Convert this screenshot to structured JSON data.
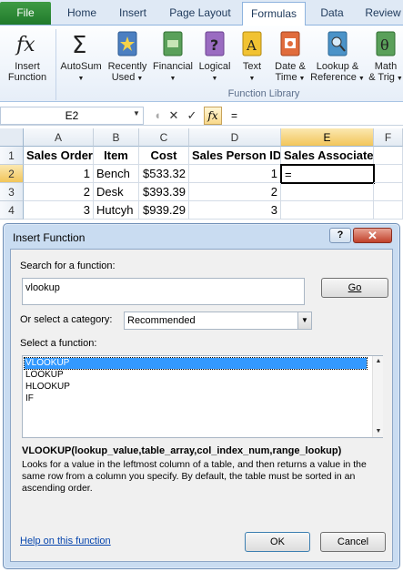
{
  "ribbon": {
    "tabs": [
      "File",
      "Home",
      "Insert",
      "Page Layout",
      "Formulas",
      "Data",
      "Review"
    ],
    "active_tab": "Formulas",
    "buttons": [
      {
        "label": "Insert\nFunction",
        "icon": "fx-icon"
      },
      {
        "label": "AutoSum",
        "icon": "sigma-icon"
      },
      {
        "label": "Recently\nUsed",
        "icon": "star-book-icon"
      },
      {
        "label": "Financial",
        "icon": "money-book-icon"
      },
      {
        "label": "Logical",
        "icon": "question-book-icon"
      },
      {
        "label": "Text",
        "icon": "text-book-icon"
      },
      {
        "label": "Date &\nTime",
        "icon": "calendar-book-icon"
      },
      {
        "label": "Lookup &\nReference",
        "icon": "magnifier-book-icon"
      },
      {
        "label": "Math\n& Trig",
        "icon": "theta-book-icon"
      }
    ],
    "group_label": "Function Library"
  },
  "formula_bar": {
    "name_box": "E2",
    "formula": "="
  },
  "grid": {
    "columns": [
      "A",
      "B",
      "C",
      "D",
      "E",
      "F"
    ],
    "rows": [
      "1",
      "2",
      "3",
      "4"
    ],
    "cells": [
      [
        "Sales Order",
        "Item",
        "Cost",
        "Sales Person ID",
        "Sales Associate"
      ],
      [
        "1",
        "Bench",
        "$533.32",
        "1",
        "="
      ],
      [
        "2",
        "Desk",
        "$393.39",
        "2",
        ""
      ],
      [
        "3",
        "Hutcyh",
        "$939.29",
        "3",
        ""
      ]
    ],
    "active_cell": "E2"
  },
  "dialog": {
    "title": "Insert Function",
    "help_glyph": "?",
    "close_glyph": "✕",
    "search_label": "Search for a function:",
    "search_value": "vlookup",
    "go_label": "Go",
    "category_label": "Or select a category:",
    "category_value": "Recommended",
    "function_label": "Select a function:",
    "functions": [
      "VLOOKUP",
      "LOOKUP",
      "HLOOKUP",
      "IF"
    ],
    "selected_function": "VLOOKUP",
    "signature": "VLOOKUP(lookup_value,table_array,col_index_num,range_lookup)",
    "description": "Looks for a value in the leftmost column of a table, and then returns a value in the same row from a column you specify. By default, the table must be sorted in an ascending order.",
    "help_link": "Help on this function",
    "ok_label": "OK",
    "cancel_label": "Cancel"
  }
}
